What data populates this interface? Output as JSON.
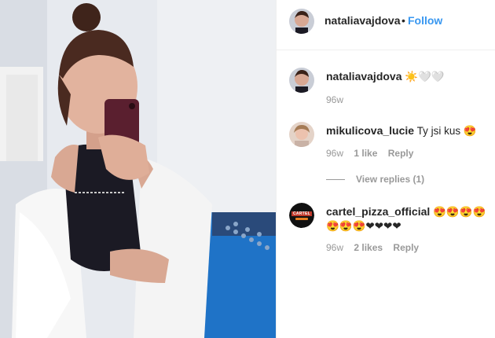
{
  "post": {
    "author": "nataliavajdova",
    "follow_separator": "•",
    "follow_label": "Follow"
  },
  "caption": {
    "author": "nataliavajdova",
    "text": "☀️🤍🤍",
    "time": "96w"
  },
  "comments": [
    {
      "author": "mikulicova_lucie",
      "text": "Ty jsi kus 😍",
      "time": "96w",
      "likes": "1 like",
      "reply": "Reply"
    },
    {
      "author": "cartel_pizza_official",
      "text": "😍😍😍😍😍😍😍❤❤❤❤",
      "time": "96w",
      "likes": "2 likes",
      "reply": "Reply"
    }
  ],
  "view_replies": "View replies (1)",
  "colors": {
    "follow": "#3897f0",
    "meta": "#999999",
    "divider": "#efefef"
  },
  "icons": [
    "avatar",
    "cartel-logo"
  ]
}
